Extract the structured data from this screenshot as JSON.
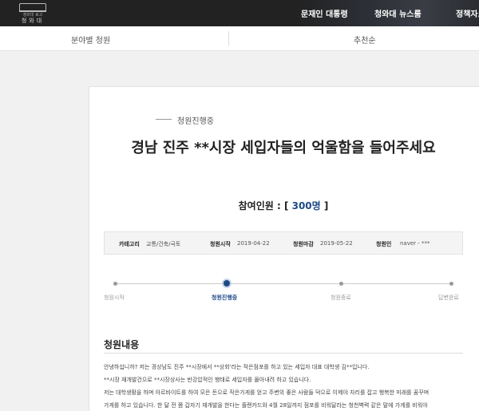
{
  "header": {
    "logo_sub": "청와대 로고",
    "logo_name": "청와대",
    "nav": [
      "문재인 대통령",
      "청와대 뉴스룸",
      "정책자료"
    ]
  },
  "subnav": {
    "left": "분야별 청원",
    "right": "추천순"
  },
  "petition": {
    "status": "청원진행중",
    "title": "경남 진주 **시장 세입자들의 억울함을 들어주세요",
    "count_label": "참여인원 : [ ",
    "count_value": "300명",
    "count_suffix": " ]",
    "meta": [
      {
        "key": "카테고리",
        "value": "교통/건축/국토"
      },
      {
        "key": "청원시작",
        "value": "2019-04-22"
      },
      {
        "key": "청원마감",
        "value": "2019-05-22"
      },
      {
        "key": "청원인",
        "value": "naver - ***"
      }
    ],
    "steps": [
      "청원시작",
      "청원진행중",
      "청원종료",
      "답변완료"
    ],
    "active_step_color": "#1f4a87",
    "section_title": "청원내용",
    "body": [
      "안녕하십니까? 저는 경상남도 진주 **시장에서 **상회'라는 작은점포를 하고 있는 세입자 대표 대학생 김**입니다.",
      "**시장 재개발건으로 **시장상사는 반강압적인 행태로 세입자를 몰아내려 하고 있습니다.",
      "저는 대학생활을 하며 아르바이트를 하여 모은 돈으로 작은가게를 얻고 주변의 좋은 사람들 덕으로 이제야 자리를 잡고 행복한 미래를 꿈꾸며",
      "가게를 하고 있습니다. 한 달 전 쯤 갑자기 재개발을 한다는 플랜카드와 4월 28일까지 점포를 비워달라는 청천벽력 같은 말에 가게를 비워야"
    ]
  }
}
